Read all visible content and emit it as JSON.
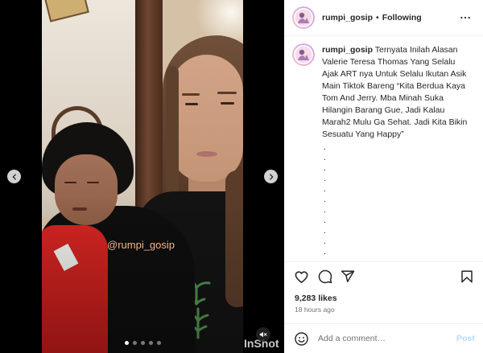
{
  "media": {
    "overlay_text": "@rumpi_gosip",
    "app_watermark": "InShot",
    "carousel": {
      "count": 5,
      "active_index": 0
    },
    "controls": {
      "prev_icon": "chevron-left-icon",
      "next_icon": "chevron-right-icon",
      "audio_icon": "speaker-muted-icon"
    }
  },
  "header": {
    "username": "rumpi_gosip",
    "separator": "•",
    "follow_status": "Following",
    "more_icon": "more-horizontal-icon"
  },
  "caption": {
    "username": "rumpi_gosip",
    "text": "Ternyata Inilah Alasan Valerie Teresa Thomas Yang Selalu Ajak ART nya Untuk Selalu Ikutan Asik Main Tiktok Bareng “Kita Berdua Kaya Tom And Jerry. Mba Minah Suka Hilangin Barang Gue, Jadi Kalau Marah2 Mulu Ga Sehat. Jadi Kita Bikin Sesuatu Yang Happy”",
    "trailing_lines": [
      ".",
      ".",
      ".",
      ".",
      ".",
      ".",
      ".",
      ".",
      ".",
      ".",
      "."
    ]
  },
  "actions": {
    "like_icon": "heart-icon",
    "comment_icon": "comment-icon",
    "share_icon": "send-icon",
    "save_icon": "bookmark-icon"
  },
  "stats": {
    "likes": "9,283 likes",
    "posted": "18 hours ago"
  },
  "comment_box": {
    "emoji_icon": "smiley-icon",
    "placeholder": "Add a comment…",
    "submit_label": "Post"
  },
  "colors": {
    "text": "#262626",
    "muted": "#737373",
    "divider": "#efefef",
    "post_button": "#b3dbff",
    "watermark": "#f4b58a",
    "media_background": "#000000"
  }
}
